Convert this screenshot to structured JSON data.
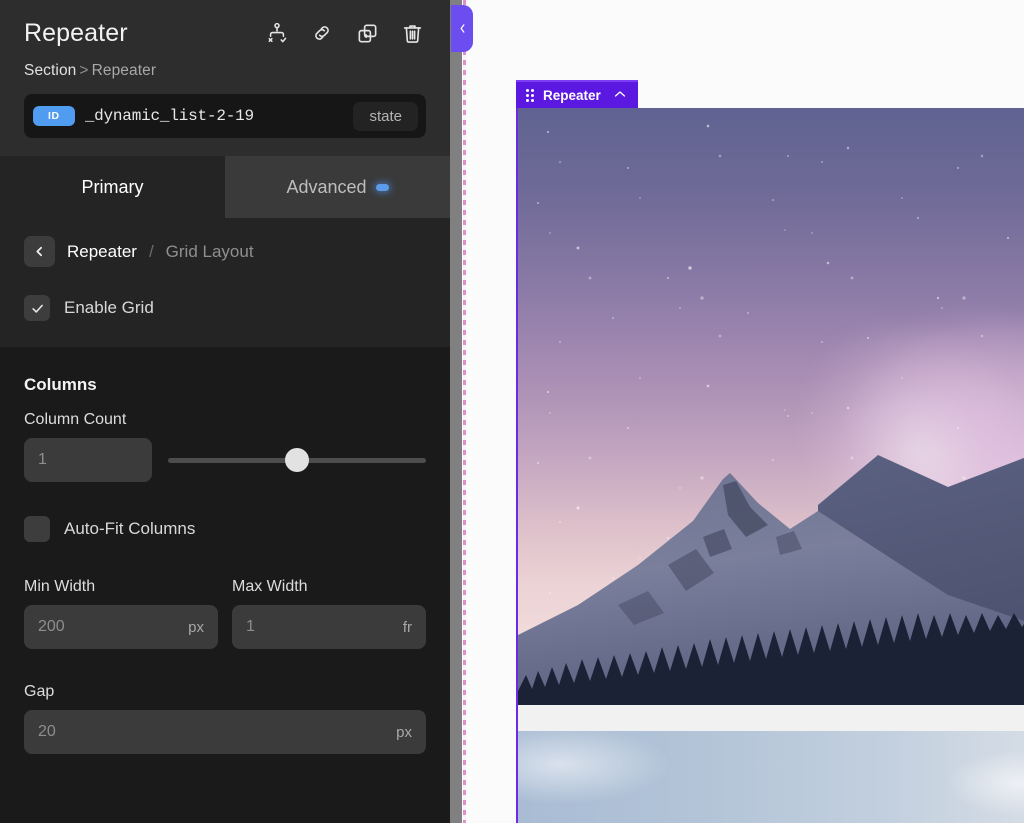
{
  "panel": {
    "title": "Repeater",
    "header_icons": [
      {
        "name": "conditions-icon",
        "label": "Conditions"
      },
      {
        "name": "link-icon",
        "label": "Link"
      },
      {
        "name": "duplicate-icon",
        "label": "Duplicate"
      },
      {
        "name": "trash-icon",
        "label": "Delete"
      }
    ],
    "breadcrumb": {
      "parent": "Section",
      "separator": ">",
      "current": "Repeater"
    },
    "id_bar": {
      "pill": "ID",
      "value": "_dynamic_list-2-19",
      "state_button": "state"
    },
    "tabs": [
      {
        "label": "Primary",
        "active": true,
        "badge": false
      },
      {
        "label": "Advanced",
        "active": false,
        "badge": true
      }
    ],
    "sub_breadcrumb": {
      "back_icon": "chevron-left-icon",
      "current": "Repeater",
      "slash": "/",
      "next": "Grid Layout"
    },
    "enable_grid": {
      "label": "Enable Grid",
      "checked": true,
      "check_glyph": "✓"
    },
    "columns": {
      "group_title": "Columns",
      "column_count": {
        "label": "Column Count",
        "value": "1",
        "slider_percent": 50
      },
      "auto_fit": {
        "label": "Auto-Fit Columns",
        "checked": false
      },
      "min_width": {
        "label": "Min Width",
        "value": "200",
        "unit": "px"
      },
      "max_width": {
        "label": "Max Width",
        "value": "1",
        "unit": "fr"
      },
      "gap": {
        "label": "Gap",
        "value": "20",
        "unit": "px"
      }
    }
  },
  "canvas": {
    "collapse_tab": {
      "name": "collapse-panel-tab",
      "glyph": "❮"
    },
    "element_label": {
      "name": "Repeater",
      "drag_handle": "drag-dots-handle",
      "collapse_glyph": "︿"
    },
    "accent_color": "#5b18e0",
    "items": [
      {
        "name": "repeater-item-1",
        "alt": "Starry night sky over snowy mountain with pine forest"
      },
      {
        "name": "repeater-item-2",
        "alt": "Pale blue sky"
      }
    ]
  }
}
